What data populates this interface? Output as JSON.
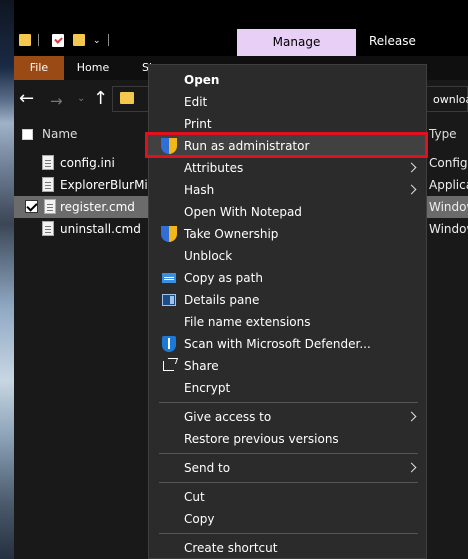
{
  "titlebar": {
    "contextual_tab": "Manage",
    "title_fragment": "Release"
  },
  "ribbon": {
    "tabs": [
      "File",
      "Home",
      "Sh"
    ]
  },
  "navigation": {
    "address_fragment": "ownload"
  },
  "file_list": {
    "columns": {
      "name": "Name",
      "type": "Type"
    },
    "rows": [
      {
        "name": "config.ini",
        "type": "Configu",
        "selected": false
      },
      {
        "name": "ExplorerBlurMica",
        "type": "Applica",
        "selected": false
      },
      {
        "name": "register.cmd",
        "type": "Window",
        "selected": true
      },
      {
        "name": "uninstall.cmd",
        "type": "Window",
        "selected": false
      }
    ]
  },
  "context_menu": {
    "items": [
      {
        "label": "Open",
        "bold": true
      },
      {
        "label": "Edit"
      },
      {
        "label": "Print"
      },
      {
        "label": "Run as administrator",
        "icon": "uac-shield-icon",
        "highlighted": true
      },
      {
        "label": "Attributes",
        "submenu": true
      },
      {
        "label": "Hash",
        "submenu": true
      },
      {
        "label": "Open With Notepad"
      },
      {
        "label": "Take Ownership",
        "icon": "uac-shield-icon"
      },
      {
        "label": "Unblock"
      },
      {
        "label": "Copy as path",
        "icon": "copy-path-icon"
      },
      {
        "label": "Details pane",
        "icon": "details-pane-icon"
      },
      {
        "label": "File name extensions"
      },
      {
        "label": "Scan with Microsoft Defender...",
        "icon": "defender-icon"
      },
      {
        "label": "Share",
        "icon": "share-icon"
      },
      {
        "label": "Encrypt"
      },
      {
        "label": "Give access to",
        "submenu": true
      },
      {
        "label": "Restore previous versions"
      },
      {
        "label": "Send to",
        "submenu": true
      },
      {
        "label": "Cut"
      },
      {
        "label": "Copy"
      },
      {
        "label": "Create shortcut"
      }
    ]
  },
  "colors": {
    "highlight_border": "#e0101e",
    "contextual_tab_bg": "#e8cff5",
    "file_tab_bg": "#9a4a14",
    "menu_bg": "#2b2b2b"
  }
}
